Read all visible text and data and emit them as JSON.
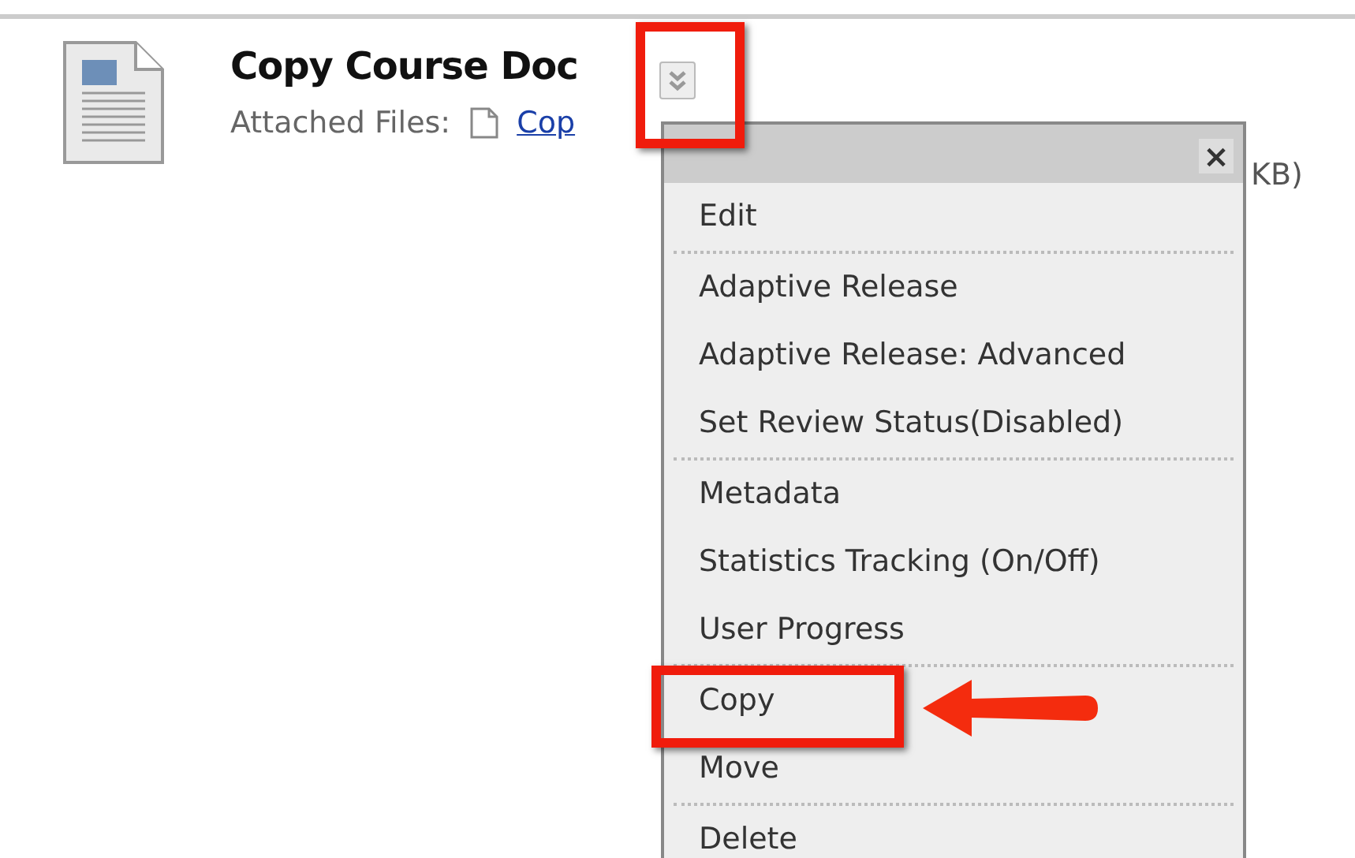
{
  "item": {
    "title": "Copy Course Doc",
    "attached_label": "Attached Files:",
    "file_link": "Cop",
    "file_size_tail": "KB)"
  },
  "menu_button": {
    "callout": true
  },
  "menu": {
    "close": "×",
    "groups": [
      [
        {
          "label": "Edit",
          "callout": false
        }
      ],
      [
        {
          "label": "Adaptive Release",
          "callout": false
        },
        {
          "label": "Adaptive Release: Advanced",
          "callout": false
        },
        {
          "label": "Set Review Status(Disabled)",
          "callout": false
        }
      ],
      [
        {
          "label": "Metadata",
          "callout": false
        },
        {
          "label": "Statistics Tracking (On/Off)",
          "callout": false
        },
        {
          "label": "User Progress",
          "callout": false
        }
      ],
      [
        {
          "label": "Copy",
          "callout": true
        },
        {
          "label": "Move",
          "callout": false
        }
      ],
      [
        {
          "label": "Delete",
          "callout": false
        }
      ]
    ]
  }
}
